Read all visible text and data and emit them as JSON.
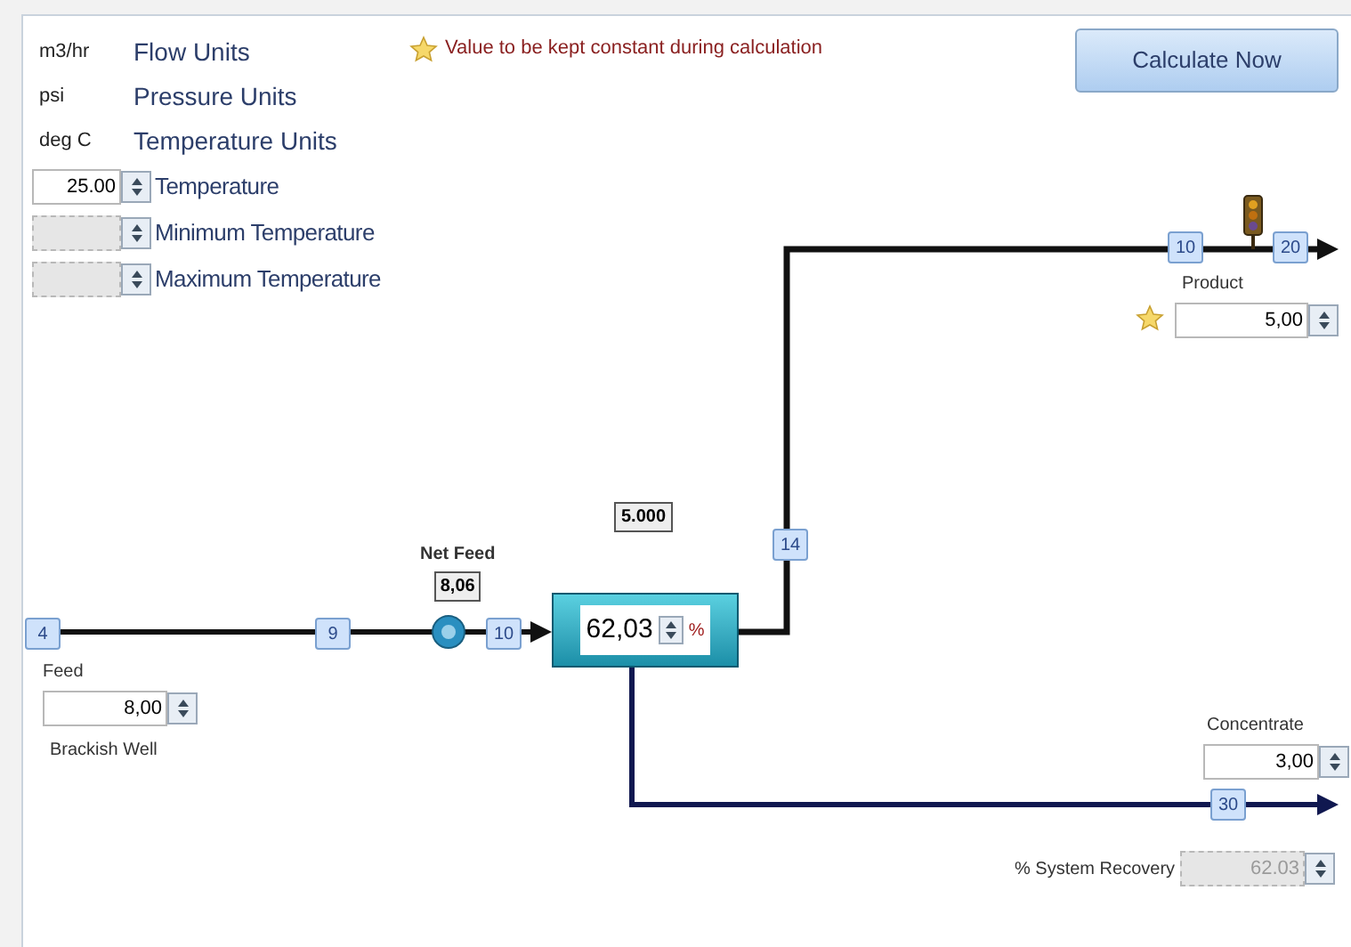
{
  "units": [
    {
      "value": "m3/hr",
      "label": "Flow Units"
    },
    {
      "value": "psi",
      "label": "Pressure Units"
    },
    {
      "value": "deg C",
      "label": "Temperature Units"
    }
  ],
  "temperature_fields": [
    {
      "value": "25.00",
      "label": "Temperature",
      "disabled": false
    },
    {
      "label": "Minimum Temperature",
      "disabled": true
    },
    {
      "label": "Maximum Temperature",
      "disabled": true
    }
  ],
  "legend": {
    "text": "Value to be kept constant during calculation"
  },
  "calculate_button": "Calculate Now",
  "diagram": {
    "nodes": [
      "4",
      "9",
      "10",
      "14",
      "10",
      "20",
      "30"
    ],
    "net_feed": {
      "label": "Net Feed",
      "value": "8,06"
    },
    "flow_value": "5.000",
    "recovery_box": {
      "value": "62,03",
      "unit": "%"
    },
    "feed": {
      "label": "Feed",
      "value": "8,00",
      "source": "Brackish Well"
    },
    "product": {
      "label": "Product",
      "value": "5,00",
      "constant": true
    },
    "concentrate": {
      "label": "Concentrate",
      "value": "3,00"
    },
    "system_recovery": {
      "label": "% System Recovery",
      "value": "62.03",
      "disabled": true
    }
  }
}
